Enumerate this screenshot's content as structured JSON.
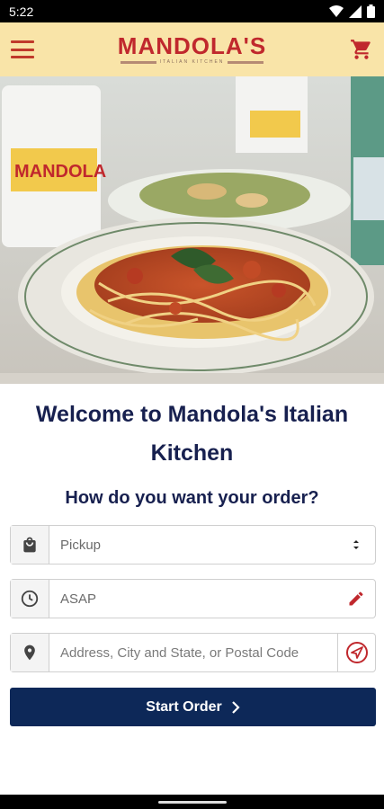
{
  "status_bar": {
    "time": "5:22"
  },
  "header": {
    "logo_text": "MANDOLA'S",
    "logo_subtext": "ITALIAN KITCHEN",
    "brand_color": "#c0282d",
    "header_bg": "#f9e4a8"
  },
  "hero": {
    "cup_text": "MANDOLA"
  },
  "main": {
    "welcome": "Welcome to Mandola's Italian Kitchen",
    "question": "How do you want your order?",
    "order_type": {
      "value": "Pickup",
      "icon": "shopping-bag-icon",
      "trail_icon": "select-arrows-icon"
    },
    "time": {
      "value": "ASAP",
      "icon": "clock-icon",
      "trail_icon": "pencil-icon"
    },
    "address": {
      "placeholder": "Address, City and State, or Postal Code",
      "icon": "location-pin-icon",
      "trail_icon": "locate-me-icon"
    },
    "start_button": "Start Order",
    "accent": "#0d2858"
  }
}
